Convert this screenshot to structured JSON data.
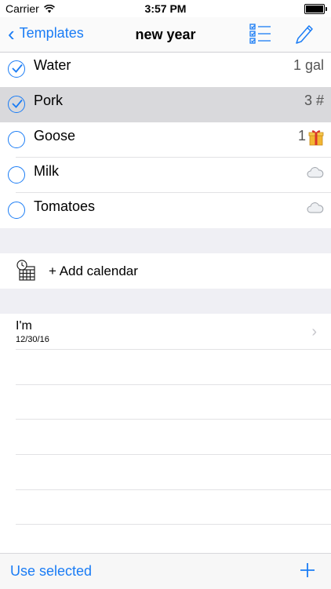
{
  "status_bar": {
    "carrier": "Carrier",
    "time": "3:57 PM"
  },
  "nav": {
    "back_label": "Templates",
    "title": "new year"
  },
  "items": [
    {
      "name": "Water",
      "quantity": "1 gal",
      "checked": true,
      "selected": false,
      "icon": ""
    },
    {
      "name": "Pork",
      "quantity": "3 #",
      "checked": true,
      "selected": true,
      "icon": ""
    },
    {
      "name": "Goose",
      "quantity": "1",
      "checked": false,
      "selected": false,
      "icon": "gift-icon"
    },
    {
      "name": "Milk",
      "quantity": "",
      "checked": false,
      "selected": false,
      "icon": "cloud-icon"
    },
    {
      "name": "Tomatoes",
      "quantity": "",
      "checked": false,
      "selected": false,
      "icon": "cloud-icon"
    }
  ],
  "calendar": {
    "add_label": "+ Add calendar",
    "icon": "calendar-clock-icon"
  },
  "entries": [
    {
      "title": "I'm",
      "date": "12/30/16"
    }
  ],
  "toolbar": {
    "use_selected_label": "Use selected",
    "add_icon": "plus-icon"
  },
  "colors": {
    "accent": "#1a7cf5",
    "selected_row": "#d9d9dc",
    "group_bg": "#efeff4"
  }
}
